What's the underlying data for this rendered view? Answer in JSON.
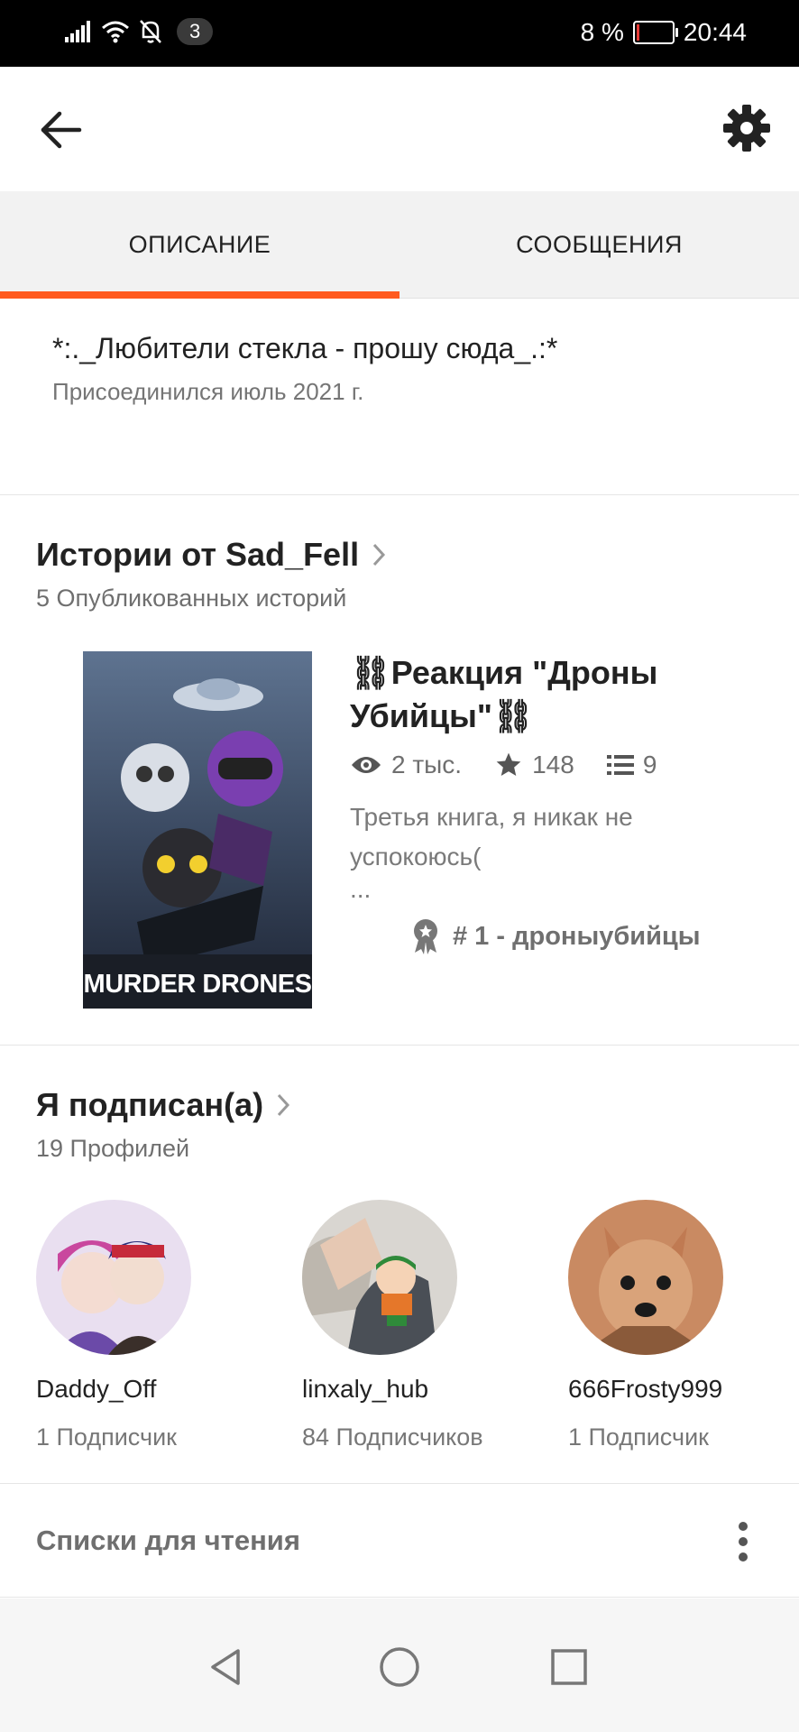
{
  "status_bar": {
    "badge": "3",
    "battery": "8 %",
    "battery_level": 0.08,
    "time": "20:44",
    "accent_color": "#e53935"
  },
  "topbar": {
    "back_icon": "arrow-left-icon",
    "settings_icon": "gear-icon"
  },
  "tabs": [
    {
      "label": "ОПИСАНИЕ",
      "active": true
    },
    {
      "label": "СООБЩЕНИЯ",
      "active": false
    }
  ],
  "accent_color": "#ff5a1f",
  "description": {
    "text": "*:._Любители стекла - прошу сюда_.:*",
    "joined": "Присоединился июль 2021 г."
  },
  "stories": {
    "heading": "Истории от Sad_Fell",
    "count": "5 Опубликованных историй",
    "item": {
      "cover_text": "MURDER DRONES",
      "title": "⛓Реакция \"Дроны Убийцы\"⛓",
      "reads": "2 тыс.",
      "votes": "148",
      "parts": "9",
      "description_line1": "Третья книга, я никак не",
      "description_line2": "успокоюсь(",
      "description_line3": "...",
      "rank": "# 1 - дроныубийцы"
    }
  },
  "following": {
    "heading": "Я подписан(а)",
    "count": "19 Профилей",
    "profiles": [
      {
        "name": "Daddy_Off",
        "followers": "1 Подписчик"
      },
      {
        "name": "linxaly_hub",
        "followers": "84 Подписчиков"
      },
      {
        "name": "666Frosty999",
        "followers": "1 Подписчик"
      }
    ]
  },
  "reading_lists": {
    "label": "Списки для чтения"
  },
  "nav": {
    "back": "triangle-back-icon",
    "home": "circle-home-icon",
    "recent": "square-recents-icon"
  }
}
